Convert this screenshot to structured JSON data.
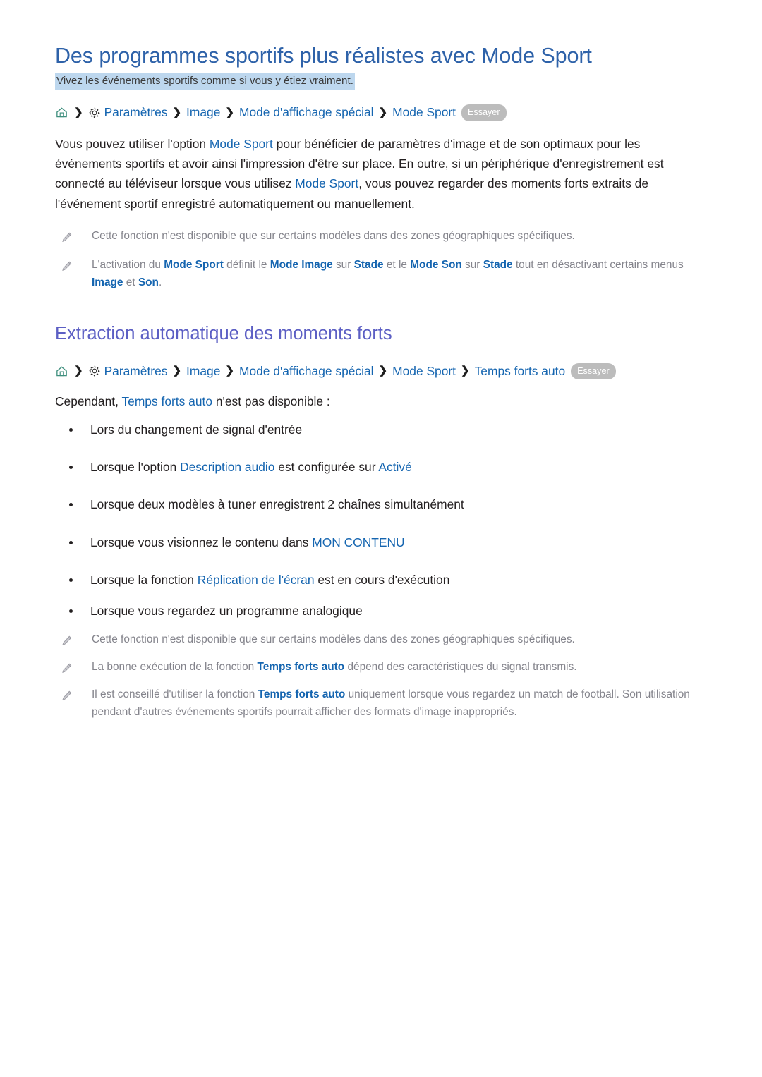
{
  "document": {
    "title": "Des programmes sportifs plus réalistes avec Mode Sport",
    "subtitle": "Vivez les événements sportifs comme si vous y étiez vraiment."
  },
  "breadcrumb_1": {
    "home_icon": "home-icon",
    "gear_icon": "gear-icon",
    "separator": "❯",
    "items": [
      {
        "label": "Paramètres"
      },
      {
        "label": "Image"
      },
      {
        "label": "Mode d'affichage spécial"
      },
      {
        "label": "Mode Sport"
      }
    ],
    "try_badge": "Essayer"
  },
  "intro_paragraph": {
    "part1": "Vous pouvez utiliser l'option ",
    "link1": "Mode Sport",
    "part2": " pour bénéficier de paramètres d'image et de son optimaux pour les événements sportifs et avoir ainsi l'impression d'être sur place. En outre, si un périphérique d'enregistrement est connecté au téléviseur lorsque vous utilisez ",
    "link2": "Mode Sport",
    "part3": ", vous pouvez regarder des moments forts extraits de l'événement sportif enregistré automatiquement ou manuellement."
  },
  "notes_top": [
    {
      "icon": "pencil-icon",
      "segments": [
        {
          "text": "Cette fonction n'est disponible que sur certains modèles dans des zones géographiques spécifiques.",
          "link": false
        }
      ]
    },
    {
      "icon": "pencil-icon",
      "segments": [
        {
          "text": "L'activation du ",
          "link": false
        },
        {
          "text": "Mode Sport",
          "link": true
        },
        {
          "text": " définit le ",
          "link": false
        },
        {
          "text": "Mode Image",
          "link": true
        },
        {
          "text": " sur ",
          "link": false
        },
        {
          "text": "Stade",
          "link": true
        },
        {
          "text": " et le ",
          "link": false
        },
        {
          "text": "Mode Son",
          "link": true
        },
        {
          "text": " sur ",
          "link": false
        },
        {
          "text": "Stade",
          "link": true
        },
        {
          "text": " tout en désactivant certains menus ",
          "link": false
        },
        {
          "text": "Image",
          "link": true
        },
        {
          "text": " et ",
          "link": false
        },
        {
          "text": "Son",
          "link": true
        },
        {
          "text": ".",
          "link": false
        }
      ]
    }
  ],
  "section_2": {
    "title": "Extraction automatique des moments forts"
  },
  "breadcrumb_2": {
    "home_icon": "home-icon",
    "gear_icon": "gear-icon",
    "separator": "❯",
    "items": [
      {
        "label": "Paramètres"
      },
      {
        "label": "Image"
      },
      {
        "label": "Mode d'affichage spécial"
      },
      {
        "label": "Mode Sport"
      },
      {
        "label": "Temps forts auto"
      }
    ],
    "try_badge": "Essayer"
  },
  "lead": {
    "part1": "Cependant, ",
    "link1": "Temps forts auto",
    "part2": " n'est pas disponible :"
  },
  "bullets": [
    {
      "segments": [
        {
          "text": "Lors du changement de signal d'entrée",
          "link": false
        }
      ]
    },
    {
      "segments": [
        {
          "text": "Lorsque l'option ",
          "link": false
        },
        {
          "text": "Description audio",
          "link": true
        },
        {
          "text": " est configurée sur ",
          "link": false
        },
        {
          "text": "Activé",
          "link": true
        }
      ]
    },
    {
      "segments": [
        {
          "text": "Lorsque deux modèles à tuner enregistrent 2 chaînes simultanément",
          "link": false
        }
      ]
    },
    {
      "segments": [
        {
          "text": "Lorsque vous visionnez le contenu dans ",
          "link": false
        },
        {
          "text": "MON CONTENU",
          "link": true
        }
      ]
    },
    {
      "segments": [
        {
          "text": "Lorsque la fonction ",
          "link": false
        },
        {
          "text": "Réplication de l'écran",
          "link": true
        },
        {
          "text": " est en cours d'exécution",
          "link": false
        }
      ]
    },
    {
      "segments": [
        {
          "text": "Lorsque vous regardez un programme analogique",
          "link": false
        }
      ]
    }
  ],
  "notes_bottom": [
    {
      "icon": "pencil-icon",
      "segments": [
        {
          "text": "Cette fonction n'est disponible que sur certains modèles dans des zones géographiques spécifiques.",
          "link": false
        }
      ]
    },
    {
      "icon": "pencil-icon",
      "segments": [
        {
          "text": "La bonne exécution de la fonction ",
          "link": false
        },
        {
          "text": "Temps forts auto",
          "link": true
        },
        {
          "text": " dépend des caractéristiques du signal transmis.",
          "link": false
        }
      ]
    },
    {
      "icon": "pencil-icon",
      "segments": [
        {
          "text": "Il est conseillé d'utiliser la fonction ",
          "link": false
        },
        {
          "text": "Temps forts auto",
          "link": true
        },
        {
          "text": " uniquement lorsque vous regardez un match de football. Son utilisation pendant d'autres événements sportifs pourrait afficher des formats d'image inappropriés.",
          "link": false
        }
      ]
    }
  ],
  "colors": {
    "title_blue": "#2e62a9",
    "section_purple": "#5c5fc4",
    "link_blue": "#1565b0",
    "note_gray": "#84848c",
    "highlight_bg": "#bdd7ee",
    "badge_gray": "#bcbcbc",
    "home_icon_green": "#3f8f7e",
    "gear_icon_dark": "#2b2b2b"
  }
}
